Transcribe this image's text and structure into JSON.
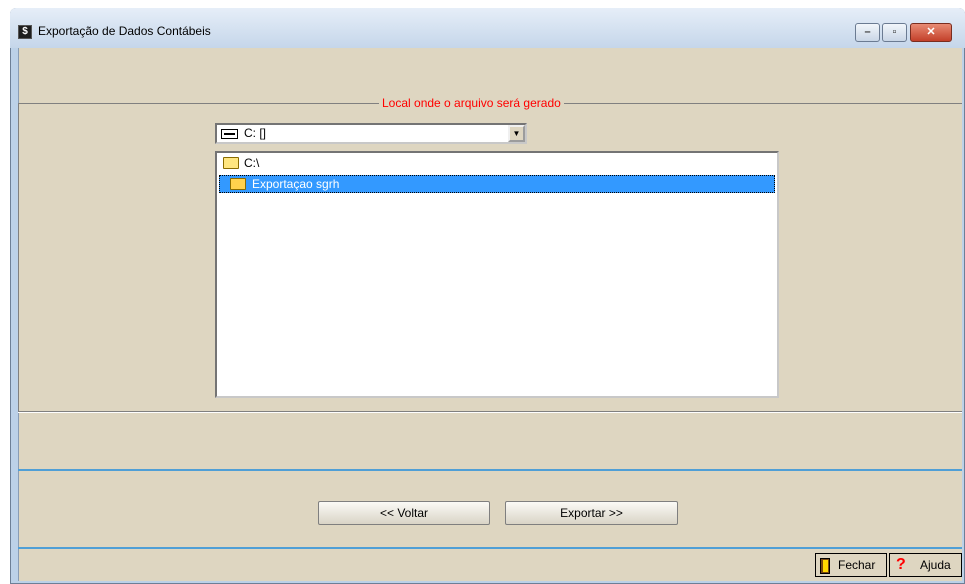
{
  "window": {
    "title": "Exportação de Dados Contábeis",
    "buttons": {
      "minimize": "–",
      "maximize": "▫",
      "close": "✕"
    }
  },
  "group": {
    "legend": "Local onde o arquivo será gerado"
  },
  "drive_select": {
    "value": "C: []",
    "drop_glyph": "▼"
  },
  "folders": [
    {
      "name": "C:\\",
      "selected": false
    },
    {
      "name": "Exportaçao sgrh",
      "selected": true
    }
  ],
  "actions": {
    "back_label": "<< Voltar",
    "export_label": "Exportar >>"
  },
  "statusbar": {
    "close_label": "Fechar",
    "help_label": "Ajuda",
    "help_glyph": "?"
  },
  "colors": {
    "legend": "#ff0000",
    "client_bg": "#ded6c1",
    "selection": "#3399ff",
    "separator": "#4f9fd6"
  },
  "icons": [
    "app-icon",
    "drive-icon",
    "folder-icon",
    "open-folder-icon",
    "door-icon",
    "help-icon"
  ]
}
